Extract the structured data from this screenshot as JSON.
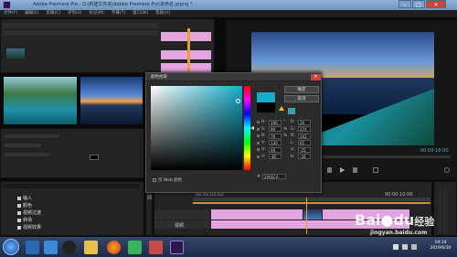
{
  "window": {
    "title": "Adobe Premiere Pro - D:\\新建文件夹\\Adobe Premiere Pro\\未命名.prproj *"
  },
  "menu": [
    "文件(F)",
    "编辑(E)",
    "剪辑(C)",
    "序列(S)",
    "标记(M)",
    "字幕(T)",
    "窗口(W)",
    "帮助(H)"
  ],
  "dialog": {
    "title": "颜色拾取",
    "ok_label": "确定",
    "cancel_label": "取消",
    "web_safe_label": "仅 Web 颜色",
    "hex_label": "#",
    "hex_value": "14AECA",
    "fields": [
      {
        "label": "H:",
        "value": "190",
        "unit": "°",
        "label2": "R:",
        "value2": "20"
      },
      {
        "label": "S:",
        "value": "90",
        "unit": "%",
        "label2": "G:",
        "value2": "174"
      },
      {
        "label": "B:",
        "value": "79",
        "unit": "%",
        "label2": "B:",
        "value2": "202"
      },
      {
        "label": "Y:",
        "value": "130",
        "unit": "",
        "label2": "L:",
        "value2": "65"
      },
      {
        "label": "U:",
        "value": "48",
        "unit": "",
        "label2": "a:",
        "value2": "-25"
      },
      {
        "label": "V:",
        "value": "-85",
        "unit": "",
        "label2": "b:",
        "value2": "-26"
      }
    ],
    "colors": {
      "new": "#14aeca",
      "old": "#000000"
    }
  },
  "program_monitor": {
    "timecode": "00:00:16:00"
  },
  "project_items": [
    "输入",
    "颜色",
    "视频过渡",
    "转场",
    "视频效果"
  ],
  "timeline": {
    "ruler_left": "00:00:05:00",
    "ruler_right": "00:00:10:00",
    "clip_label": "视频"
  },
  "taskbar": {
    "time": "19:14",
    "date": "2019/6/30"
  },
  "watermark": {
    "brand": "Bai",
    "brand2": "du",
    "suffix": "经验",
    "url": "jingyan.baidu.com"
  }
}
